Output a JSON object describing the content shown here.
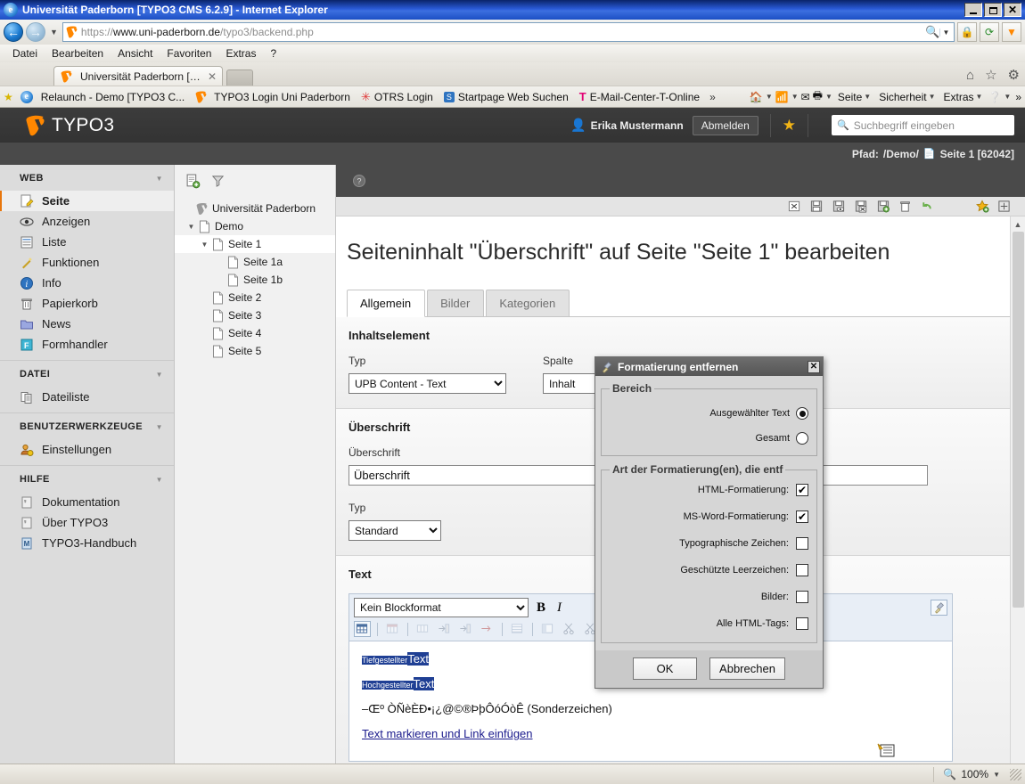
{
  "browser": {
    "window_title": "Universität Paderborn [TYPO3 CMS 6.2.9] - Internet Explorer",
    "url_scheme": "https",
    "url_sep": "://",
    "url_domain": "www.uni-paderborn.de",
    "url_path": "/typo3/backend.php",
    "menu": [
      "Datei",
      "Bearbeiten",
      "Ansicht",
      "Favoriten",
      "Extras",
      "?"
    ],
    "tab_label": "Universität Paderborn [TYPO...",
    "tab_close": "✕",
    "favorites": [
      "Relaunch - Demo [TYPO3 C...",
      "TYPO3 Login Uni Paderborn",
      "OTRS  Login",
      "Startpage Web Suchen",
      "E-Mail-Center-T-Online"
    ],
    "fav_overflow": "»",
    "command_bar": [
      "Seite",
      "Sicherheit",
      "Extras"
    ],
    "command_overflow": "»",
    "status_zoom": "100%",
    "window_buttons": {
      "minimize": "_",
      "maximize": "❐",
      "close": "✕"
    }
  },
  "typo3": {
    "logo_text": "TYPO3",
    "user_name": "Erika Mustermann",
    "logout_label": "Abmelden",
    "search_placeholder": "Suchbegriff eingeben",
    "path_label": "Pfad:",
    "path_value": "/Demo/",
    "path_page": "Seite 1 [62042]",
    "modules": [
      {
        "group": "WEB",
        "items": [
          {
            "label": "Seite",
            "icon": "page-edit-icon",
            "active": true
          },
          {
            "label": "Anzeigen",
            "icon": "eye-icon",
            "active": false
          },
          {
            "label": "Liste",
            "icon": "list-icon",
            "active": false
          },
          {
            "label": "Funktionen",
            "icon": "wand-icon",
            "active": false
          },
          {
            "label": "Info",
            "icon": "info-icon",
            "active": false
          },
          {
            "label": "Papierkorb",
            "icon": "trash-icon",
            "active": false
          },
          {
            "label": "News",
            "icon": "folder-icon",
            "active": false
          },
          {
            "label": "Formhandler",
            "icon": "form-icon",
            "active": false
          }
        ]
      },
      {
        "group": "DATEI",
        "items": [
          {
            "label": "Dateiliste",
            "icon": "filelist-icon",
            "active": false
          }
        ]
      },
      {
        "group": "BENUTZERWERKZEUGE",
        "items": [
          {
            "label": "Einstellungen",
            "icon": "user-settings-icon",
            "active": false
          }
        ]
      },
      {
        "group": "HILFE",
        "items": [
          {
            "label": "Dokumentation",
            "icon": "doc-icon",
            "active": false
          },
          {
            "label": "Über TYPO3",
            "icon": "doc-icon",
            "active": false
          },
          {
            "label": "TYPO3-Handbuch",
            "icon": "manual-icon",
            "active": false
          }
        ]
      }
    ],
    "tree": [
      {
        "label": "Universität Paderborn",
        "depth": 0,
        "icon": "typo3-root-icon",
        "toggle": "",
        "selected": false
      },
      {
        "label": "Demo",
        "depth": 1,
        "icon": "page-icon",
        "toggle": "▼",
        "selected": false
      },
      {
        "label": "Seite 1",
        "depth": 2,
        "icon": "page-icon",
        "toggle": "▼",
        "selected": true
      },
      {
        "label": "Seite 1a",
        "depth": 3,
        "icon": "page-icon",
        "toggle": "",
        "selected": false
      },
      {
        "label": "Seite 1b",
        "depth": 3,
        "icon": "page-icon",
        "toggle": "",
        "selected": false
      },
      {
        "label": "Seite 2",
        "depth": 2,
        "icon": "page-icon",
        "toggle": "",
        "selected": false
      },
      {
        "label": "Seite 3",
        "depth": 2,
        "icon": "page-icon",
        "toggle": "",
        "selected": false
      },
      {
        "label": "Seite 4",
        "depth": 2,
        "icon": "page-icon",
        "toggle": "",
        "selected": false
      },
      {
        "label": "Seite 5",
        "depth": 2,
        "icon": "page-icon",
        "toggle": "",
        "selected": false
      }
    ],
    "content": {
      "page_title": "Seiteninhalt \"Überschrift\" auf Seite \"Seite 1\" bearbeiten",
      "tabs": [
        {
          "label": "Allgemein",
          "active": true
        },
        {
          "label": "Bilder",
          "active": false
        },
        {
          "label": "Kategorien",
          "active": false
        }
      ],
      "section_inhaltselement": {
        "title": "Inhaltselement",
        "typ_label": "Typ",
        "typ_value": "UPB Content - Text",
        "spalte_label": "Spalte",
        "spalte_value": "Inhalt"
      },
      "section_ueberschrift": {
        "title": "Überschrift",
        "ueberschrift_label": "Überschrift",
        "ueberschrift_value": "Überschrift",
        "typ_label": "Typ",
        "typ_value": "Standard"
      },
      "section_text": {
        "title": "Text",
        "blockformat_value": "Kein Blockformat",
        "bold_label": "B",
        "italic_label": "I",
        "body": {
          "line1_small": "Tiefgestellter",
          "line1_big": "Text",
          "line2_small": "Hochgestellter",
          "line2_big": "Text",
          "line3": "–Œº ÒÑèÈÐ•¡¿@©®ÞþÔóÓòÊ (Sonderzeichen)",
          "line4_link": "Text markieren und Link einfügen"
        }
      }
    }
  },
  "dialog": {
    "title": "Formatierung entfernen",
    "close_label": "✕",
    "fieldset_bereich": {
      "legend": "Bereich",
      "options": [
        {
          "label": "Ausgewählter Text",
          "checked": true
        },
        {
          "label": "Gesamt",
          "checked": false
        }
      ]
    },
    "fieldset_art": {
      "legend": "Art der Formatierung(en), die entf",
      "options": [
        {
          "label": "HTML-Formatierung:",
          "checked": true
        },
        {
          "label": "MS-Word-Formatierung:",
          "checked": true
        },
        {
          "label": "Typographische Zeichen:",
          "checked": false
        },
        {
          "label": "Geschützte Leerzeichen:",
          "checked": false
        },
        {
          "label": "Bilder:",
          "checked": false
        },
        {
          "label": "Alle HTML-Tags:",
          "checked": false
        }
      ],
      "check_glyph": "✔"
    },
    "ok_label": "OK",
    "cancel_label": "Abbrechen"
  },
  "colors": {
    "typo3_orange": "#e8760c",
    "titlebar_blue": "#2a5ad7",
    "dark_gray": "#333333",
    "selection_blue": "#1f3f94",
    "link_blue": "#1a1a8c"
  }
}
